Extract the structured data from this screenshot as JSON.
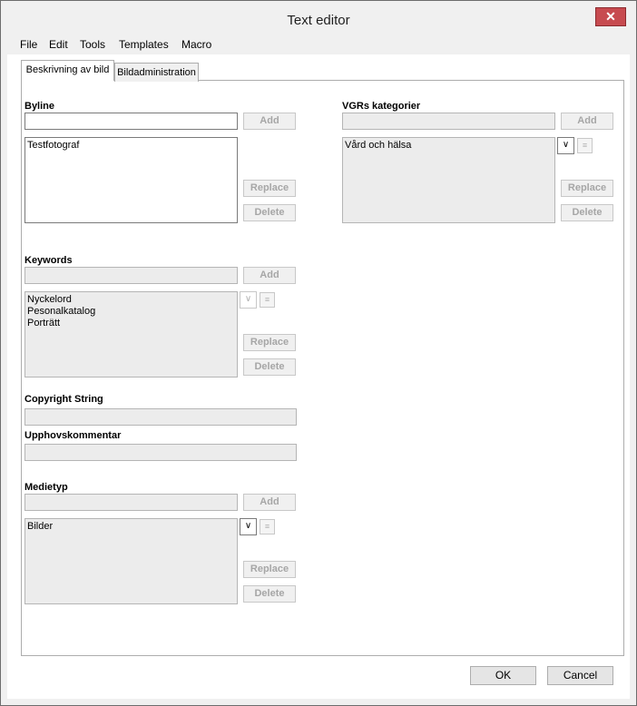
{
  "window": {
    "title": "Text editor",
    "close_label": "✕"
  },
  "menu": {
    "items": [
      "File",
      "Edit",
      "Tools",
      "Templates",
      "Macro"
    ]
  },
  "tabs": [
    {
      "label": "Beskrivning av bild"
    },
    {
      "label": "Bildadministration"
    }
  ],
  "byline": {
    "label": "Byline",
    "input_value": "",
    "add": "Add",
    "list_items": [
      "Testfotograf"
    ],
    "replace": "Replace",
    "delete": "Delete"
  },
  "vgrs": {
    "label": "VGRs kategorier",
    "input_value": "",
    "add": "Add",
    "list_items": [
      "Vård och hälsa"
    ],
    "replace": "Replace",
    "delete": "Delete"
  },
  "keywords": {
    "label": "Keywords",
    "input_value": "",
    "add": "Add",
    "list_items": [
      "Nyckelord",
      "Pesonalkatalog",
      "Porträtt"
    ],
    "replace": "Replace",
    "delete": "Delete"
  },
  "copyright": {
    "label": "Copyright String",
    "value": ""
  },
  "upphov": {
    "label": "Upphovskommentar",
    "value": ""
  },
  "medietyp": {
    "label": "Medietyp",
    "input_value": "",
    "add": "Add",
    "list_items": [
      "Bilder"
    ],
    "replace": "Replace",
    "delete": "Delete"
  },
  "footer": {
    "ok": "OK",
    "cancel": "Cancel"
  },
  "icons": {
    "dropdown": "chevron-down-icon",
    "sort": "sort-icon",
    "close": "close-icon"
  }
}
